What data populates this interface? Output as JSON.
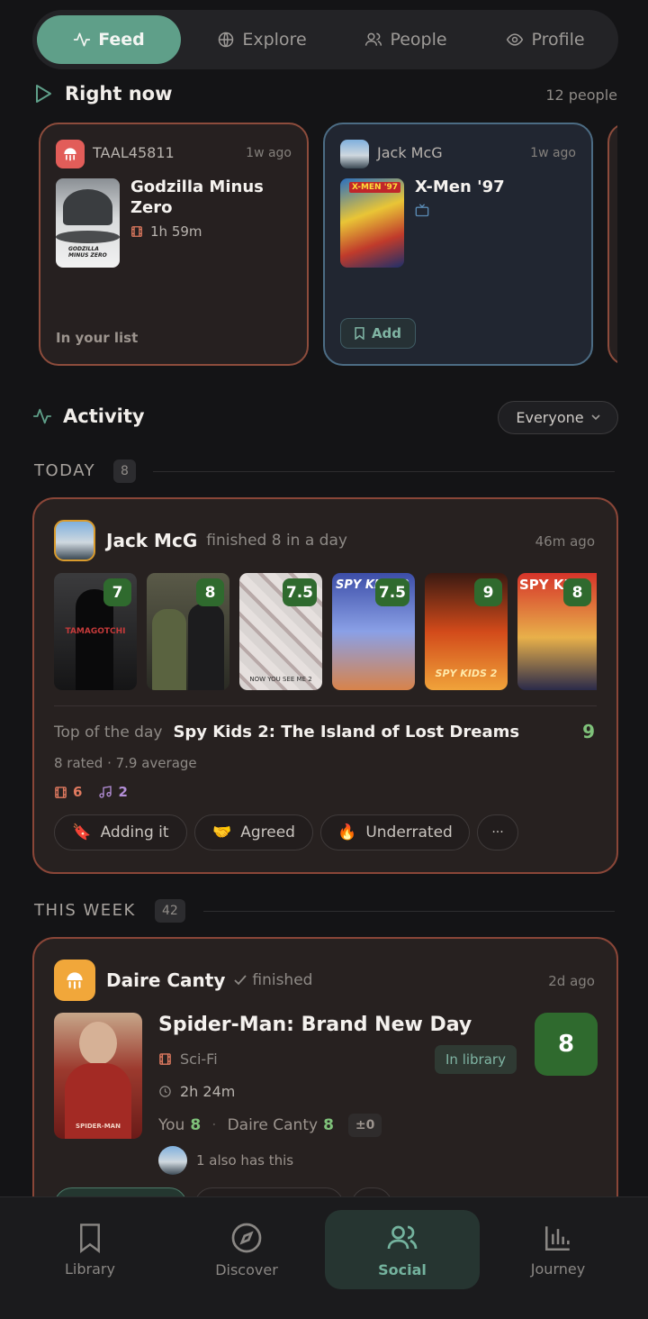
{
  "tabs": [
    {
      "label": "Feed",
      "icon": "activity-icon",
      "active": true
    },
    {
      "label": "Explore",
      "icon": "globe-icon"
    },
    {
      "label": "People",
      "icon": "people-icon"
    },
    {
      "label": "Profile",
      "icon": "eye-icon"
    }
  ],
  "right_now": {
    "title": "Right now",
    "count": "12 people",
    "cards": [
      {
        "user": "TAAL45811",
        "time": "1w ago",
        "title": "Godzilla Minus Zero",
        "runtime": "1h 59m",
        "footer": "In your list",
        "poster_text": "GODZILLA MINUS ZERO"
      },
      {
        "user": "Jack McG",
        "time": "1w ago",
        "title": "X-Men '97",
        "add_label": "Add",
        "poster_text": "X-MEN '97"
      }
    ]
  },
  "activity": {
    "title": "Activity",
    "filter": "Everyone"
  },
  "today": {
    "label": "TODAY",
    "count": "8",
    "card": {
      "user": "Jack McG",
      "action": "finished 8 in a day",
      "time": "46m ago",
      "posters": [
        {
          "score": "7",
          "poster_text": "TAMAGOTCHI"
        },
        {
          "score": "8",
          "poster_text": ""
        },
        {
          "score": "7.5",
          "poster_text": "NOW YOU SEE ME 2"
        },
        {
          "score": "7.5",
          "poster_text": "SPY KIDS 3"
        },
        {
          "score": "9",
          "poster_text": "SPY KIDS 2"
        },
        {
          "score": "8",
          "poster_text": "SPY KIDS"
        }
      ],
      "top_label": "Top of the day",
      "top_title": "Spy Kids 2: The Island of Lost Dreams",
      "top_score": "9",
      "summary": "8 rated · 7.9 average",
      "films_count": "6",
      "music_count": "2",
      "reactions": [
        {
          "emoji": "🔖",
          "label": "Adding it"
        },
        {
          "emoji": "🤝",
          "label": "Agreed"
        },
        {
          "emoji": "🔥",
          "label": "Underrated"
        },
        {
          "emoji": "",
          "label": "···"
        }
      ]
    }
  },
  "this_week": {
    "label": "THIS WEEK",
    "count": "42",
    "card": {
      "user": "Daire Canty",
      "action": "finished",
      "time": "2d ago",
      "title": "Spider-Man: Brand New Day",
      "genre": "Sci-Fi",
      "runtime": "2h 24m",
      "library_badge": "In library",
      "score": "8",
      "you_label": "You",
      "you_score": "8",
      "other_user": "Daire Canty",
      "other_score": "8",
      "diff": "±0",
      "also": "1 also has this",
      "poster_text": "SPIDER-MAN"
    }
  },
  "bottom_nav": [
    {
      "label": "Library",
      "icon": "bookmark-icon"
    },
    {
      "label": "Discover",
      "icon": "compass-icon"
    },
    {
      "label": "Social",
      "icon": "people-icon",
      "active": true
    },
    {
      "label": "Journey",
      "icon": "chart-icon"
    }
  ],
  "colors": {
    "accent": "#5f9f89",
    "card_border": "#8a4638",
    "score_green": "#2f6a2e",
    "score_text_green": "#7fc27a"
  }
}
